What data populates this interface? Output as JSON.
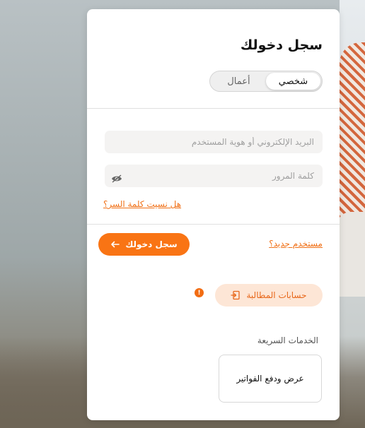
{
  "login": {
    "title": "سجل دخولك",
    "tabs": [
      {
        "label": "شخصي",
        "active": true
      },
      {
        "label": "أعمال",
        "active": false
      }
    ],
    "username_placeholder": "البريد الإلكتروني أو هوية المستخدم",
    "password_placeholder": "كلمة المرور",
    "forgot_password": "هل نسيت كلمة السر؟",
    "new_user": "مستخدم جديد؟",
    "login_button": "سجل دخولك",
    "claims_button": "حسابات المطالبة",
    "alert_badge": "!",
    "quick_services_title": "الخدمات السريعة",
    "quick_services": [
      {
        "label": "عرض ودفع الفواتير"
      }
    ]
  },
  "icons": {
    "password_toggle": "eye-icon",
    "login_arrow": "arrow-left-icon",
    "claims": "switch-account-icon"
  },
  "colors": {
    "accent": "#f97414",
    "accent_light": "#fde6d6",
    "link": "#f07017"
  }
}
